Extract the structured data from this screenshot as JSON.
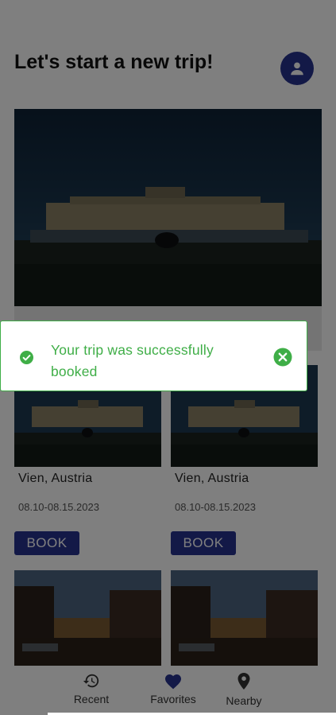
{
  "header": {
    "title": "Let's start a new trip!",
    "avatar_icon": "person-icon"
  },
  "cards": [
    {
      "name": "Vien, Austria",
      "dates": "08.10-08.15.2023",
      "book_label": "BOOK"
    },
    {
      "name": "Vien, Austria",
      "dates": "08.10-08.15.2023",
      "book_label": "BOOK"
    }
  ],
  "toast": {
    "message": "Your trip was successfully booked",
    "status_icon": "check-circle-icon",
    "close_icon": "close-circle-icon"
  },
  "bottom_nav": {
    "items": [
      {
        "label": "Recent",
        "icon": "history-icon"
      },
      {
        "label": "Favorites",
        "icon": "heart-icon"
      },
      {
        "label": "Nearby",
        "icon": "location-pin-icon"
      }
    ]
  },
  "colors": {
    "brand": "#26328f",
    "success": "#3fae47",
    "overlay": "rgba(0,0,0,0.5)"
  }
}
